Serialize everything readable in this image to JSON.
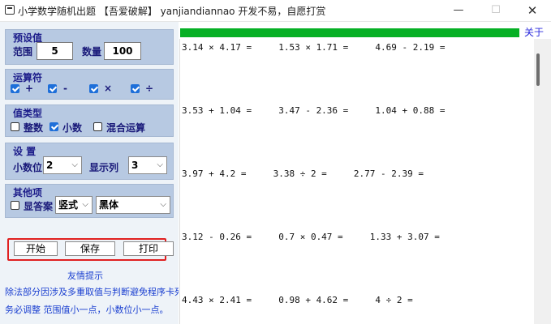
{
  "window": {
    "title": "小学数学随机出题 【吾爱破解】 yanjiandiannao 开发不易，自愿打赏",
    "min_glyph": "—",
    "max_glyph": "☐",
    "close_glyph": "✕"
  },
  "presets": {
    "title": "预设值",
    "range_label": "范围",
    "range_value": "5",
    "count_label": "数量",
    "count_value": "100"
  },
  "operators": {
    "title": "运算符",
    "items": [
      {
        "label": "+",
        "checked": true
      },
      {
        "label": "-",
        "checked": true
      },
      {
        "label": "×",
        "checked": true
      },
      {
        "label": "÷",
        "checked": true
      }
    ]
  },
  "value_type": {
    "title": "值类型",
    "items": [
      {
        "label": "整数",
        "checked": false
      },
      {
        "label": "小数",
        "checked": true
      },
      {
        "label": "混合运算",
        "checked": false
      }
    ]
  },
  "settings": {
    "title": "设 置",
    "decimals_label": "小数位",
    "decimals_value": "2",
    "columns_label": "显示列",
    "columns_value": "3"
  },
  "other": {
    "title": "其他项",
    "show_answer_label": "显答案",
    "show_answer_checked": false,
    "format_value": "竖式",
    "font_value": "黑体"
  },
  "buttons": {
    "start": "开始",
    "save": "保存",
    "print": "打印"
  },
  "tips": {
    "title": "友情提示",
    "line1": "除法部分因涉及多重取值与判断避免程序卡死",
    "line2": "务必调整 范围值小一点，小数位小一点。"
  },
  "about": "关于",
  "progress": 1.0,
  "colors": {
    "progress": "#06b025",
    "panel": "#b7c9e2",
    "highlight": "#e02020",
    "label": "#1a1a7a"
  },
  "questions": [
    "3.14 × 4.17 =     1.53 × 1.71 =     4.69 - 2.19 =",
    "3.53 + 1.04 =     3.47 - 2.36 =     1.04 + 0.88 =",
    "3.97 + 4.2 =     3.38 ÷ 2 =     2.77 - 2.39 =",
    "3.12 - 0.26 =     0.7 × 0.47 =     1.33 + 3.07 =",
    "4.43 × 2.41 =     0.98 + 4.62 =     4 ÷ 2 ="
  ]
}
